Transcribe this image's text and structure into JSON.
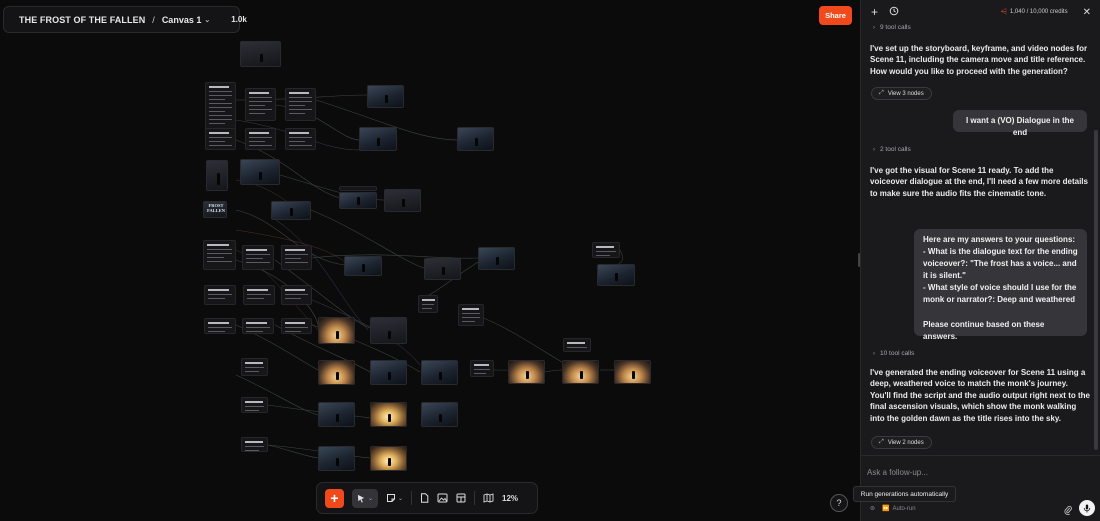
{
  "header": {
    "project_title": "THE FROST OF THE FALLEN",
    "separator": "/",
    "canvas_name": "Canvas 1",
    "member_count": "1.0k"
  },
  "share_label": "Share",
  "toolbar": {
    "zoom": "12%"
  },
  "help_label": "?",
  "tooltip": "Run generations automatically",
  "poster_text": "FROST\nFALLEN",
  "panel": {
    "credits": "1,040 / 10,000 credits",
    "messages": [
      {
        "kind": "tools",
        "text": "9 tool calls"
      },
      {
        "kind": "assistant",
        "text": "I've set up the storyboard, keyframe, and video nodes for Scene 11, including the camera move and title reference. How would you like to proceed with the generation?"
      },
      {
        "kind": "view",
        "text": "View 3 nodes"
      },
      {
        "kind": "user",
        "text": "I want a (VO) Dialogue in the end"
      },
      {
        "kind": "tools",
        "text": "2 tool calls"
      },
      {
        "kind": "assistant",
        "text": "I've got the visual for Scene 11 ready. To add the voiceover dialogue at the end, I'll need a few more details to make sure the audio fits the cinematic tone."
      },
      {
        "kind": "user",
        "text": "Here are my answers to your questions:\n- What is the dialogue text for the ending voiceover?: \"The frost has a voice... and it is silent.\"\n- What style of voice should I use for the monk or narrator?: Deep and weathered\n\nPlease continue based on these answers."
      },
      {
        "kind": "tools",
        "text": "10 tool calls"
      },
      {
        "kind": "assistant",
        "text": "I've generated the ending voiceover for Scene 11 using a deep, weathered voice to match the monk's journey. You'll find the script and the audio output right next to the final ascension visuals, which show the monk walking into the golden dawn as the title rises into the sky."
      },
      {
        "kind": "view",
        "text": "View 2 nodes"
      }
    ],
    "followup_placeholder": "Ask a follow-up...",
    "autorun_label": "Auto-run"
  },
  "colors": {
    "accent": "#f04a1c",
    "panel_bg": "#1a1a1c",
    "canvas_bg": "#0b0b0b"
  }
}
